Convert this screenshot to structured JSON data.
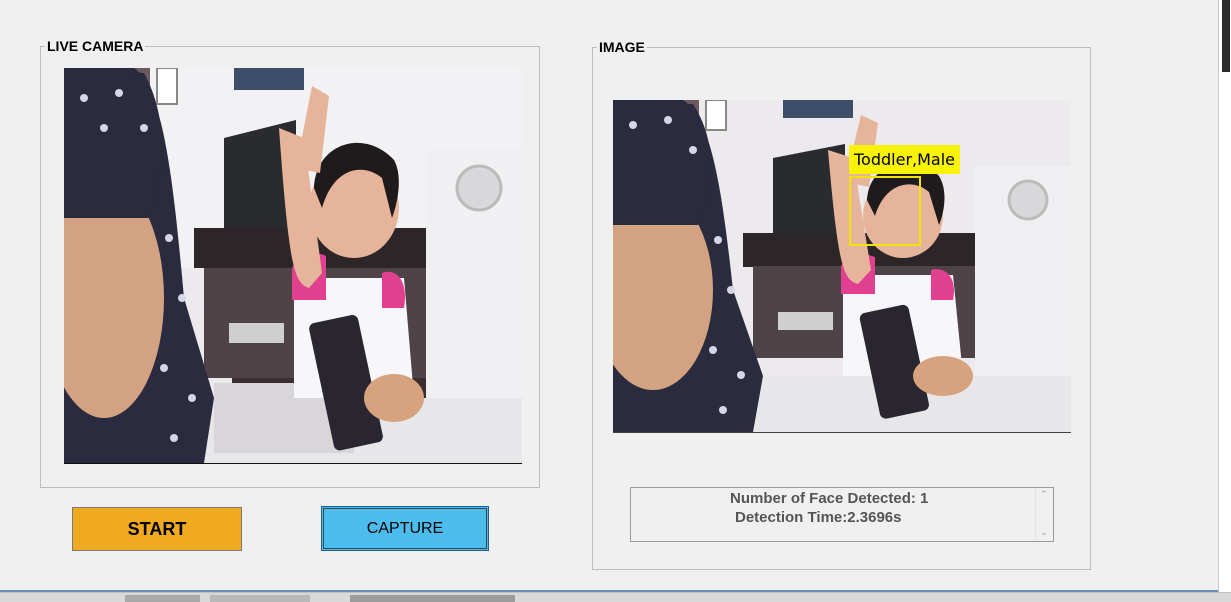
{
  "live_panel": {
    "title": "LIVE CAMERA"
  },
  "image_panel": {
    "title": "IMAGE"
  },
  "buttons": {
    "start_label": "START",
    "capture_label": "CAPTURE"
  },
  "detection": {
    "face_label": "Toddler,Male",
    "result_line_1": "Number of Face Detected: 1",
    "result_line_2": "Detection Time:2.3696s"
  },
  "scrollbar": {
    "up_icon": "scroll-up-icon",
    "down_icon": "scroll-down-icon"
  },
  "colors": {
    "start": "#efaa22",
    "capture": "#4bbcec",
    "face_box": "#f4e30a"
  }
}
